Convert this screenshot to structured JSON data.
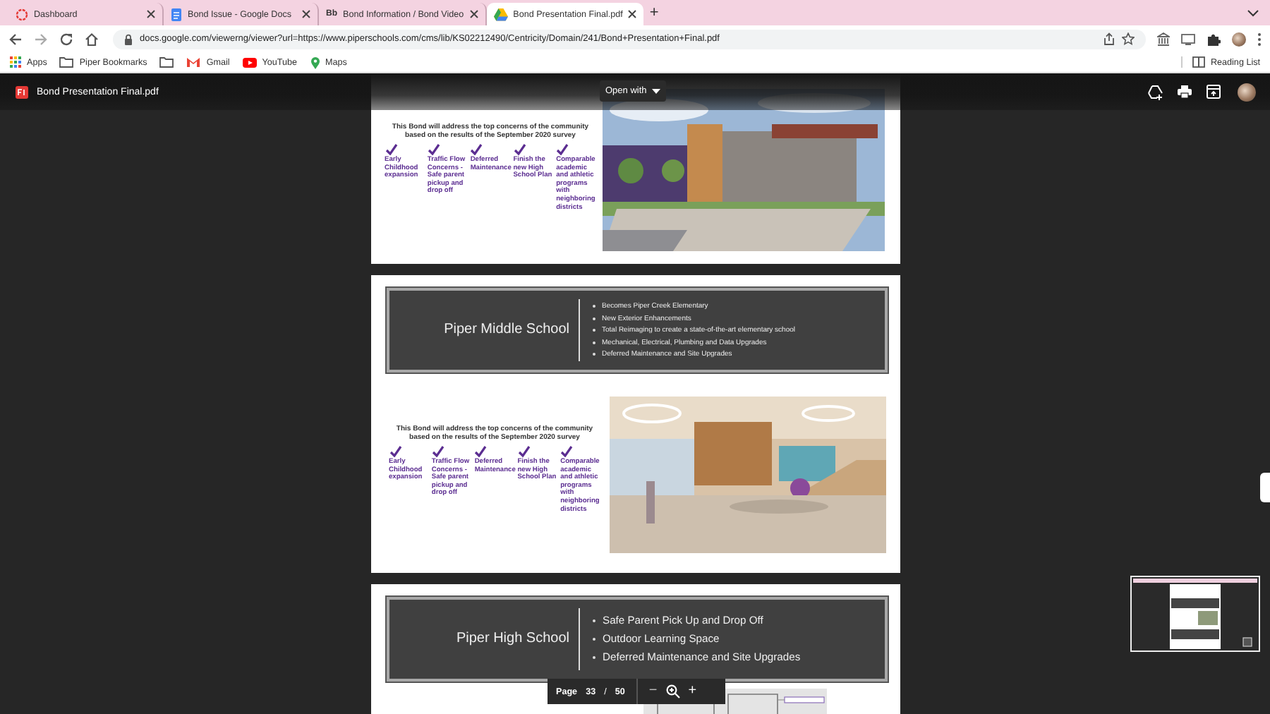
{
  "browser": {
    "tabs": [
      {
        "title": "Dashboard",
        "selected": false
      },
      {
        "title": "Bond Issue - Google Docs",
        "selected": false
      },
      {
        "title": "Bond Information / Bond Video",
        "icon_text": "Bb",
        "selected": false
      },
      {
        "title": "Bond Presentation Final.pdf",
        "selected": true
      }
    ],
    "new_tab": "+",
    "address": "docs.google.com/viewerng/viewer?url=https://www.piperschools.com/cms/lib/KS02212490/Centricity/Domain/241/Bond+Presentation+Final.pdf",
    "bookmarks": [
      {
        "label": "Apps"
      },
      {
        "label": "Piper Bookmarks"
      },
      {
        "label": "Gmail"
      },
      {
        "label": "YouTube"
      },
      {
        "label": "Maps"
      }
    ],
    "reading_list": "Reading List"
  },
  "viewer": {
    "file_name": "Bond Presentation Final.pdf",
    "open_with": "Open with",
    "pages": [
      {
        "summary": {
          "intro": "This Bond will address the top concerns of the community based on the results of the September 2020 survey",
          "items": [
            "Early Childhood expansion",
            "Traffic Flow Concerns - Safe parent pickup and drop off",
            "Deferred Maintenance",
            "Finish the new High School Plan",
            "Comparable academic and athletic programs with neighboring districts"
          ]
        },
        "kind": "picture"
      },
      {
        "banner": {
          "title": "Piper Middle School",
          "bullets": [
            "Becomes Piper Creek Elementary",
            "New Exterior Enhancements",
            "Total Reimaging to create a state-of-the-art elementary school",
            "Mechanical, Electrical, Plumbing and Data Upgrades",
            "Deferred Maintenance and Site Upgrades"
          ]
        },
        "summary": {
          "intro": "This Bond will address the top concerns of the community based on the results of the September 2020 survey",
          "items": [
            "Early Childhood expansion",
            "Traffic Flow Concerns - Safe parent pickup and drop off",
            "Deferred Maintenance",
            "Finish the new High School Plan",
            "Comparable academic and athletic programs with neighboring districts"
          ]
        },
        "kind": "picture"
      },
      {
        "banner": {
          "title": "Piper High School",
          "bullets": [
            "Safe Parent Pick Up and Drop Off",
            "Outdoor Learning Space",
            "Deferred Maintenance and Site Upgrades"
          ]
        },
        "kind": "picture"
      }
    ],
    "page_bar": {
      "label": "Page",
      "current": "33",
      "separator": "/",
      "total": "50",
      "zoom_out": "−",
      "zoom_in": "+"
    }
  }
}
